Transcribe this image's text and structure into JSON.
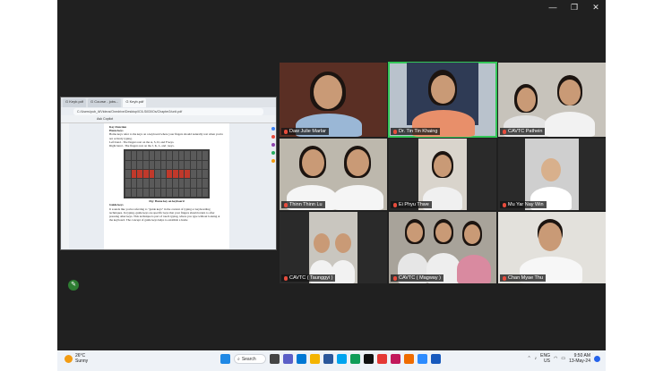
{
  "window_controls": {
    "minimize": "—",
    "restore": "❐",
    "close": "✕"
  },
  "doc": {
    "tabs": [
      "G Keyb.pdf",
      "G Course - jobs...",
      "G Keyb.pdf"
    ],
    "address": "C:/Users/pub_iii/Videos/Onedrive/Desktop/IC6-Si03/IOs/Chapter2/unit.pdf",
    "toolbar": "Ask Copilot",
    "lines": [
      "Key Function",
      "Home keys",
      "Home keys refer to the keys on a keyboard where your fingers should naturally rest when you're not actively typing.",
      "Left hand  - The fingers rest on the A, S, D, and F keys.",
      "Right hand - The fingers rest on the J, K, L, and ; keys."
    ],
    "caption": "Fig: Home key on keyboard",
    "section2": "Guide keys",
    "para2": "It sounds like you're referring to \"guide keys\" in the context of typing or keyboarding techniques. In typing, guide keys are specific keys that your fingers should return to after pressing other keys. This technique is part of touch typing, where you type without looking at the keyboard. The concept of guide keys helps to establish a home"
  },
  "participants": [
    {
      "name": "Daw Julie Marlar"
    },
    {
      "name": "Dr. Tin Tin Khaing"
    },
    {
      "name": "CAVTC Pathein"
    },
    {
      "name": "Thinn Thinn Lu"
    },
    {
      "name": "Ei Phyu Thwe"
    },
    {
      "name": "Mu Yar Nay Win"
    },
    {
      "name": "CAVTC ( Taunggyi )"
    },
    {
      "name": "CAVTC ( Magway )"
    },
    {
      "name": "Chan Myae Thu"
    }
  ],
  "taskbar": {
    "temperature": "26°C",
    "condition": "Sunny",
    "search_label": "Search",
    "lang_top": "ENG",
    "lang_bottom": "US",
    "time": "9:50 AM",
    "date": "13-May-24"
  }
}
